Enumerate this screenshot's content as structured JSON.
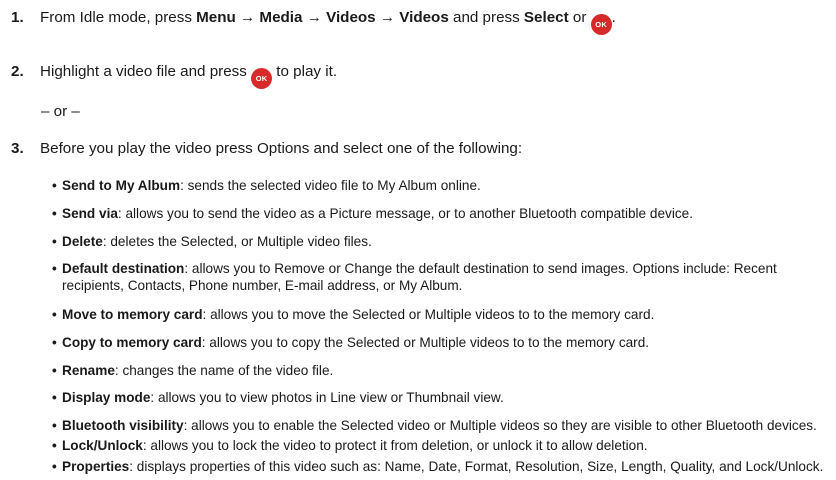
{
  "steps": [
    {
      "number": "1.",
      "pre": "From Idle mode, press ",
      "path": "Menu → Media → Videos → Videos",
      "mid": " and press ",
      "select": "Select",
      "post": " or ",
      "ok": "OK",
      "end": "."
    },
    {
      "number": "2.",
      "pre": "Highlight a video file and press ",
      "ok": "OK",
      "post": " to play it."
    },
    {
      "number": "3.",
      "text": "Before you play the video press Options and select one of the following:"
    }
  ],
  "or_text": "– or –",
  "options": [
    {
      "term": "Send to My Album",
      "desc": ": sends the selected video file to My Album online."
    },
    {
      "term": "Send via",
      "desc": ": allows you to send the video as a Picture message, or to another Bluetooth compatible device."
    },
    {
      "term": "Delete",
      "desc": ": deletes the Selected, or Multiple video files."
    },
    {
      "term": "Default destination",
      "desc": ": allows you to Remove or Change the default destination to send images. Options include: Recent recipients, Contacts, Phone number, E-mail address, or My Album."
    },
    {
      "term": "Move to memory card",
      "desc": ": allows you to move the Selected or Multiple videos to to the memory card."
    },
    {
      "term": "Copy to memory card",
      "desc": ": allows you to copy the Selected or Multiple videos to to the memory card."
    },
    {
      "term": "Rename",
      "desc": ": changes the name of the video file."
    },
    {
      "term": "Display mode",
      "desc": ": allows you to view photos in Line view or Thumbnail view."
    },
    {
      "term": "Bluetooth visibility",
      "desc": ": allows you to enable the Selected video or Multiple videos so they are visible to other Bluetooth devices."
    },
    {
      "term": "Lock/Unlock",
      "desc": ": allows you to lock the video to protect it from deletion, or unlock it to allow deletion."
    },
    {
      "term": "Properties",
      "desc": ": displays properties of this video such as: Name, Date, Format, Resolution, Size, Length, Quality, and Lock/Unlock."
    }
  ],
  "bullet_char": "•",
  "colors": {
    "ok_button": "#d72a2a",
    "text": "#1a1a1a"
  }
}
